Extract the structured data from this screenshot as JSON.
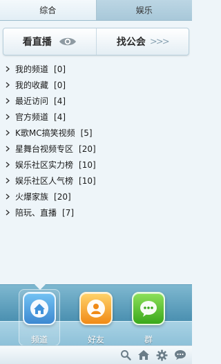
{
  "tabs": [
    {
      "label": "综合",
      "active": true
    },
    {
      "label": "娱乐",
      "active": false
    }
  ],
  "actions": {
    "live_label": "看直播",
    "guild_label": "找公会",
    "guild_arrows": ">>>"
  },
  "channels": [
    {
      "label": "我的频道",
      "count": "[0]"
    },
    {
      "label": "我的收藏",
      "count": "[0]"
    },
    {
      "label": "最近访问",
      "count": "[4]"
    },
    {
      "label": "官方频道",
      "count": "[4]"
    },
    {
      "label": "K歌MC搞笑视频",
      "count": "[5]"
    },
    {
      "label": "星舞台视频专区",
      "count": "[20]"
    },
    {
      "label": "娱乐社区实力榜",
      "count": "[10]"
    },
    {
      "label": "娱乐社区人气榜",
      "count": "[10]"
    },
    {
      "label": "火爆家族",
      "count": "[20]"
    },
    {
      "label": "陪玩、直播",
      "count": "[7]"
    }
  ],
  "dock": [
    {
      "label": "频道",
      "icon": "home-icon",
      "selected": true
    },
    {
      "label": "好友",
      "icon": "friend-icon",
      "selected": false
    },
    {
      "label": "群",
      "icon": "group-chat-icon",
      "selected": false
    }
  ],
  "toolbar_icons": [
    "search-icon",
    "home-icon",
    "gear-icon",
    "chat-bubble-icon"
  ],
  "colors": {
    "dock_top": "#7fb8d0",
    "dock_bottom": "#3d7fa1",
    "channel_icon_blue": "#1b74c9",
    "friend_icon_orange": "#f08a16",
    "group_icon_green": "#3aa81b"
  }
}
